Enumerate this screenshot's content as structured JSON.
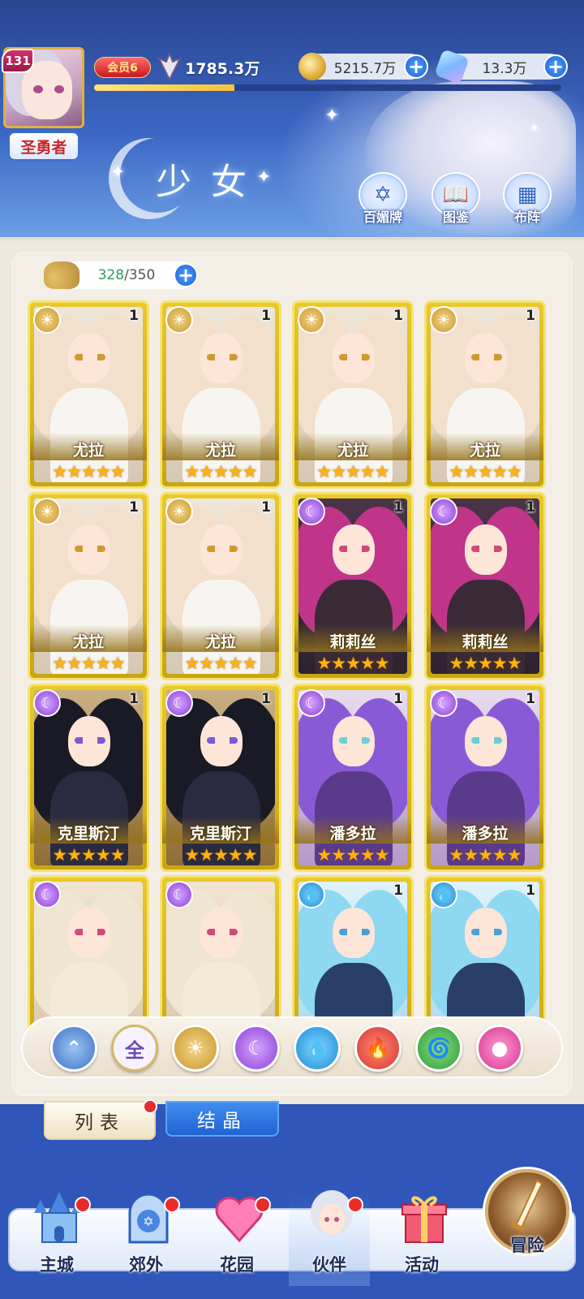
{
  "player": {
    "level": "131",
    "vip_label": "会员6",
    "power": "1785.3万",
    "title": "圣勇者",
    "exp_fraction": 0.3
  },
  "currency": {
    "gold": "5215.7万",
    "gems": "13.3万"
  },
  "page": {
    "title": "少女"
  },
  "header_buttons": [
    {
      "label": "百媚牌",
      "icon": "card-deck-icon"
    },
    {
      "label": "图鉴",
      "icon": "book-icon"
    },
    {
      "label": "布阵",
      "icon": "formation-grid-icon"
    }
  ],
  "bag": {
    "used": "328",
    "separator": "/",
    "capacity": "350"
  },
  "cards": [
    {
      "name": "尤拉",
      "count": "1",
      "element": "light",
      "stars": 5
    },
    {
      "name": "尤拉",
      "count": "1",
      "element": "light",
      "stars": 5
    },
    {
      "name": "尤拉",
      "count": "1",
      "element": "light",
      "stars": 5
    },
    {
      "name": "尤拉",
      "count": "1",
      "element": "light",
      "stars": 5
    },
    {
      "name": "尤拉",
      "count": "1",
      "element": "light",
      "stars": 5
    },
    {
      "name": "尤拉",
      "count": "1",
      "element": "light",
      "stars": 5
    },
    {
      "name": "莉莉丝",
      "count": "1",
      "element": "dark",
      "stars": 5
    },
    {
      "name": "莉莉丝",
      "count": "1",
      "element": "dark",
      "stars": 5
    },
    {
      "name": "克里斯汀",
      "count": "1",
      "element": "dark",
      "stars": 5
    },
    {
      "name": "克里斯汀",
      "count": "1",
      "element": "dark",
      "stars": 5
    },
    {
      "name": "潘多拉",
      "count": "1",
      "element": "dark",
      "stars": 5
    },
    {
      "name": "潘多拉",
      "count": "1",
      "element": "dark",
      "stars": 5
    },
    {
      "name": "",
      "count": "",
      "element": "dark",
      "stars": 0
    },
    {
      "name": "",
      "count": "",
      "element": "dark",
      "stars": 0
    },
    {
      "name": "",
      "count": "1",
      "element": "water",
      "stars": 0
    },
    {
      "name": "",
      "count": "1",
      "element": "water",
      "stars": 0
    }
  ],
  "filters": [
    {
      "icon": "sort-up-icon",
      "label": ""
    },
    {
      "icon": "all-icon",
      "label": "全"
    },
    {
      "icon": "light-element-icon",
      "label": ""
    },
    {
      "icon": "dark-element-icon",
      "label": ""
    },
    {
      "icon": "water-element-icon",
      "label": ""
    },
    {
      "icon": "fire-element-icon",
      "label": ""
    },
    {
      "icon": "wind-element-icon",
      "label": ""
    },
    {
      "icon": "heart-element-icon",
      "label": ""
    }
  ],
  "tabs": {
    "list": "列表",
    "crystal": "结晶"
  },
  "nav": [
    {
      "label": "主城",
      "icon": "castle-icon",
      "badge": true
    },
    {
      "label": "郊外",
      "icon": "portal-icon",
      "badge": true
    },
    {
      "label": "花园",
      "icon": "heart-garden-icon",
      "badge": true
    },
    {
      "label": "伙伴",
      "icon": "partner-portrait-icon",
      "badge": true
    },
    {
      "label": "活动",
      "icon": "gift-box-icon",
      "badge": false
    },
    {
      "label": "冒险",
      "icon": "adventure-sword-icon",
      "badge": false
    }
  ],
  "colors": {
    "header_blue": "#3b67c4",
    "card_gold": "#e9c92b",
    "star": "#ffb20f",
    "badge_red": "#e82b2b",
    "bag_used_green": "#2e9a6a"
  }
}
